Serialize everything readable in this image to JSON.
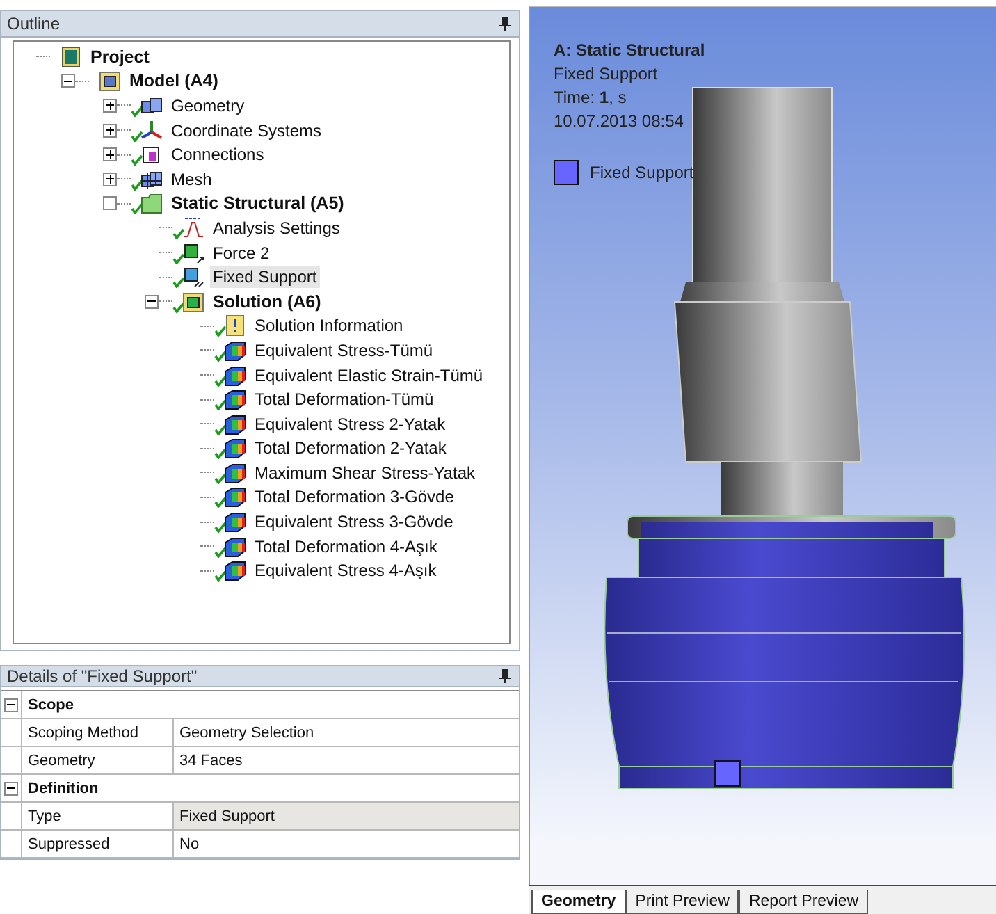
{
  "outline": {
    "title": "Outline",
    "tree": [
      {
        "label": "Project",
        "kind": "project",
        "selected": false,
        "children": [
          {
            "label": "Model (A4)",
            "kind": "model",
            "selected": false,
            "expanded": true,
            "children": [
              {
                "label": "Geometry",
                "kind": "geometry",
                "solved": true,
                "selected": false,
                "expanded": false
              },
              {
                "label": "Coordinate Systems",
                "kind": "coords",
                "solved": true,
                "selected": false,
                "expanded": false
              },
              {
                "label": "Connections",
                "kind": "connections",
                "solved": true,
                "selected": false,
                "expanded": false
              },
              {
                "label": "Mesh",
                "kind": "mesh",
                "solved": true,
                "selected": false,
                "expanded": false
              },
              {
                "label": "Static Structural (A5)",
                "kind": "folder",
                "solved": true,
                "selected": false,
                "children": [
                  {
                    "label": "Analysis Settings",
                    "kind": "settings",
                    "solved": true,
                    "selected": false
                  },
                  {
                    "label": "Force 2",
                    "kind": "force",
                    "solved": true,
                    "selected": false
                  },
                  {
                    "label": "Fixed Support",
                    "kind": "support",
                    "solved": true,
                    "selected": true
                  },
                  {
                    "label": "Solution (A6)",
                    "kind": "solution",
                    "solved": true,
                    "selected": false,
                    "expanded": true,
                    "children": [
                      {
                        "label": "Solution Information",
                        "kind": "info",
                        "solved": true,
                        "selected": false
                      },
                      {
                        "label": "Equivalent Stress-Tümü",
                        "kind": "result",
                        "solved": true,
                        "selected": false
                      },
                      {
                        "label": "Equivalent Elastic Strain-Tümü",
                        "kind": "result",
                        "solved": true,
                        "selected": false
                      },
                      {
                        "label": "Total Deformation-Tümü",
                        "kind": "result",
                        "solved": true,
                        "selected": false
                      },
                      {
                        "label": "Equivalent Stress 2-Yatak",
                        "kind": "result",
                        "solved": true,
                        "selected": false
                      },
                      {
                        "label": "Total Deformation 2-Yatak",
                        "kind": "result",
                        "solved": true,
                        "selected": false
                      },
                      {
                        "label": "Maximum Shear Stress-Yatak",
                        "kind": "result",
                        "solved": true,
                        "selected": false
                      },
                      {
                        "label": "Total Deformation 3-Gövde",
                        "kind": "result",
                        "solved": true,
                        "selected": false
                      },
                      {
                        "label": "Equivalent Stress 3-Gövde",
                        "kind": "result",
                        "solved": true,
                        "selected": false
                      },
                      {
                        "label": "Total Deformation 4-Aşık",
                        "kind": "result",
                        "solved": true,
                        "selected": false
                      },
                      {
                        "label": "Equivalent Stress 4-Aşık",
                        "kind": "result",
                        "solved": true,
                        "selected": false
                      }
                    ]
                  }
                ]
              }
            ]
          }
        ]
      }
    ]
  },
  "details": {
    "title": "Details of \"Fixed Support\"",
    "groups": [
      {
        "name": "Scope",
        "expanded": true,
        "rows": [
          {
            "label": "Scoping Method",
            "value": "Geometry Selection",
            "shaded": false
          },
          {
            "label": "Geometry",
            "value": "34 Faces",
            "shaded": false
          }
        ]
      },
      {
        "name": "Definition",
        "expanded": true,
        "rows": [
          {
            "label": "Type",
            "value": "Fixed Support",
            "shaded": true
          },
          {
            "label": "Suppressed",
            "value": "No",
            "shaded": false
          }
        ]
      }
    ]
  },
  "viewport": {
    "title": "A: Static Structural",
    "subtitle": "Fixed Support",
    "time": "Time: **1**, s",
    "date": "10.07.2013 08:54",
    "legend": {
      "label": "Fixed Support",
      "color": "#6666ff"
    }
  },
  "tabs": [
    {
      "label": "Geometry",
      "selected": true
    },
    {
      "label": "Print Preview",
      "selected": false
    },
    {
      "label": "Report Preview",
      "selected": false
    }
  ]
}
